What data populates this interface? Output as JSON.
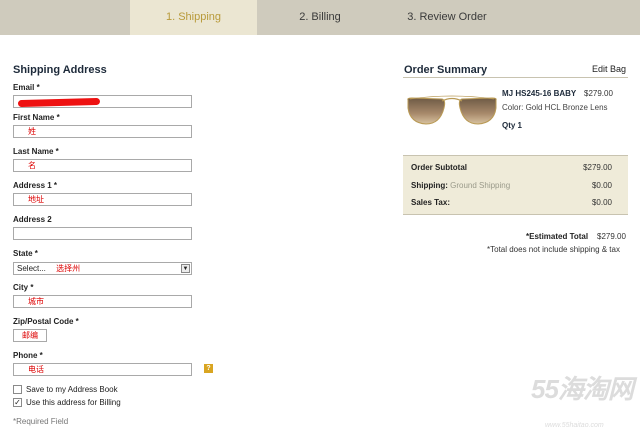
{
  "steps": [
    {
      "label": "1. Shipping",
      "active": true
    },
    {
      "label": "2. Billing",
      "active": false
    },
    {
      "label": "3. Review Order",
      "active": false
    }
  ],
  "shipping": {
    "title": "Shipping Address",
    "fields": {
      "email": {
        "label": "Email *",
        "value": ""
      },
      "first_name": {
        "label": "First Name *",
        "value": "姓"
      },
      "last_name": {
        "label": "Last Name *",
        "value": "名"
      },
      "address1": {
        "label": "Address 1 *",
        "value": "地址"
      },
      "address2": {
        "label": "Address 2",
        "value": ""
      },
      "state": {
        "label": "State *",
        "value": "Select...",
        "note": "选择州"
      },
      "city": {
        "label": "City *",
        "value": "城市"
      },
      "zip": {
        "label": "Zip/Postal Code *",
        "value": "邮编"
      },
      "phone": {
        "label": "Phone *",
        "value": "电话",
        "help_icon": "question-mark"
      }
    },
    "checkboxes": [
      {
        "label": "Save to my Address Book",
        "checked": false
      },
      {
        "label": "Use this address for Billing",
        "checked": true
      }
    ],
    "required_note": "*Required Field"
  },
  "order_summary": {
    "title": "Order Summary",
    "edit_label": "Edit Bag",
    "product": {
      "name": "MJ HS245-16 BABY",
      "price": "$279.00",
      "color": "Color: Gold HCL Bronze Lens",
      "qty": "Qty 1"
    },
    "totals": {
      "subtotal_label": "Order Subtotal",
      "subtotal_value": "$279.00",
      "shipping_label": "Shipping:",
      "shipping_method": "Ground Shipping",
      "shipping_value": "$0.00",
      "tax_label": "Sales Tax:",
      "tax_value": "$0.00"
    },
    "estimated_label": "*Estimated Total",
    "estimated_value": "$279.00",
    "note": "*Total does not include shipping & tax"
  },
  "watermark": {
    "logo": "55海淘网",
    "url": "www.55haitao.com"
  },
  "colors": {
    "active_step_text": "#b89a3a",
    "required_red": "#dd1111",
    "help_icon": "#d9a521"
  }
}
